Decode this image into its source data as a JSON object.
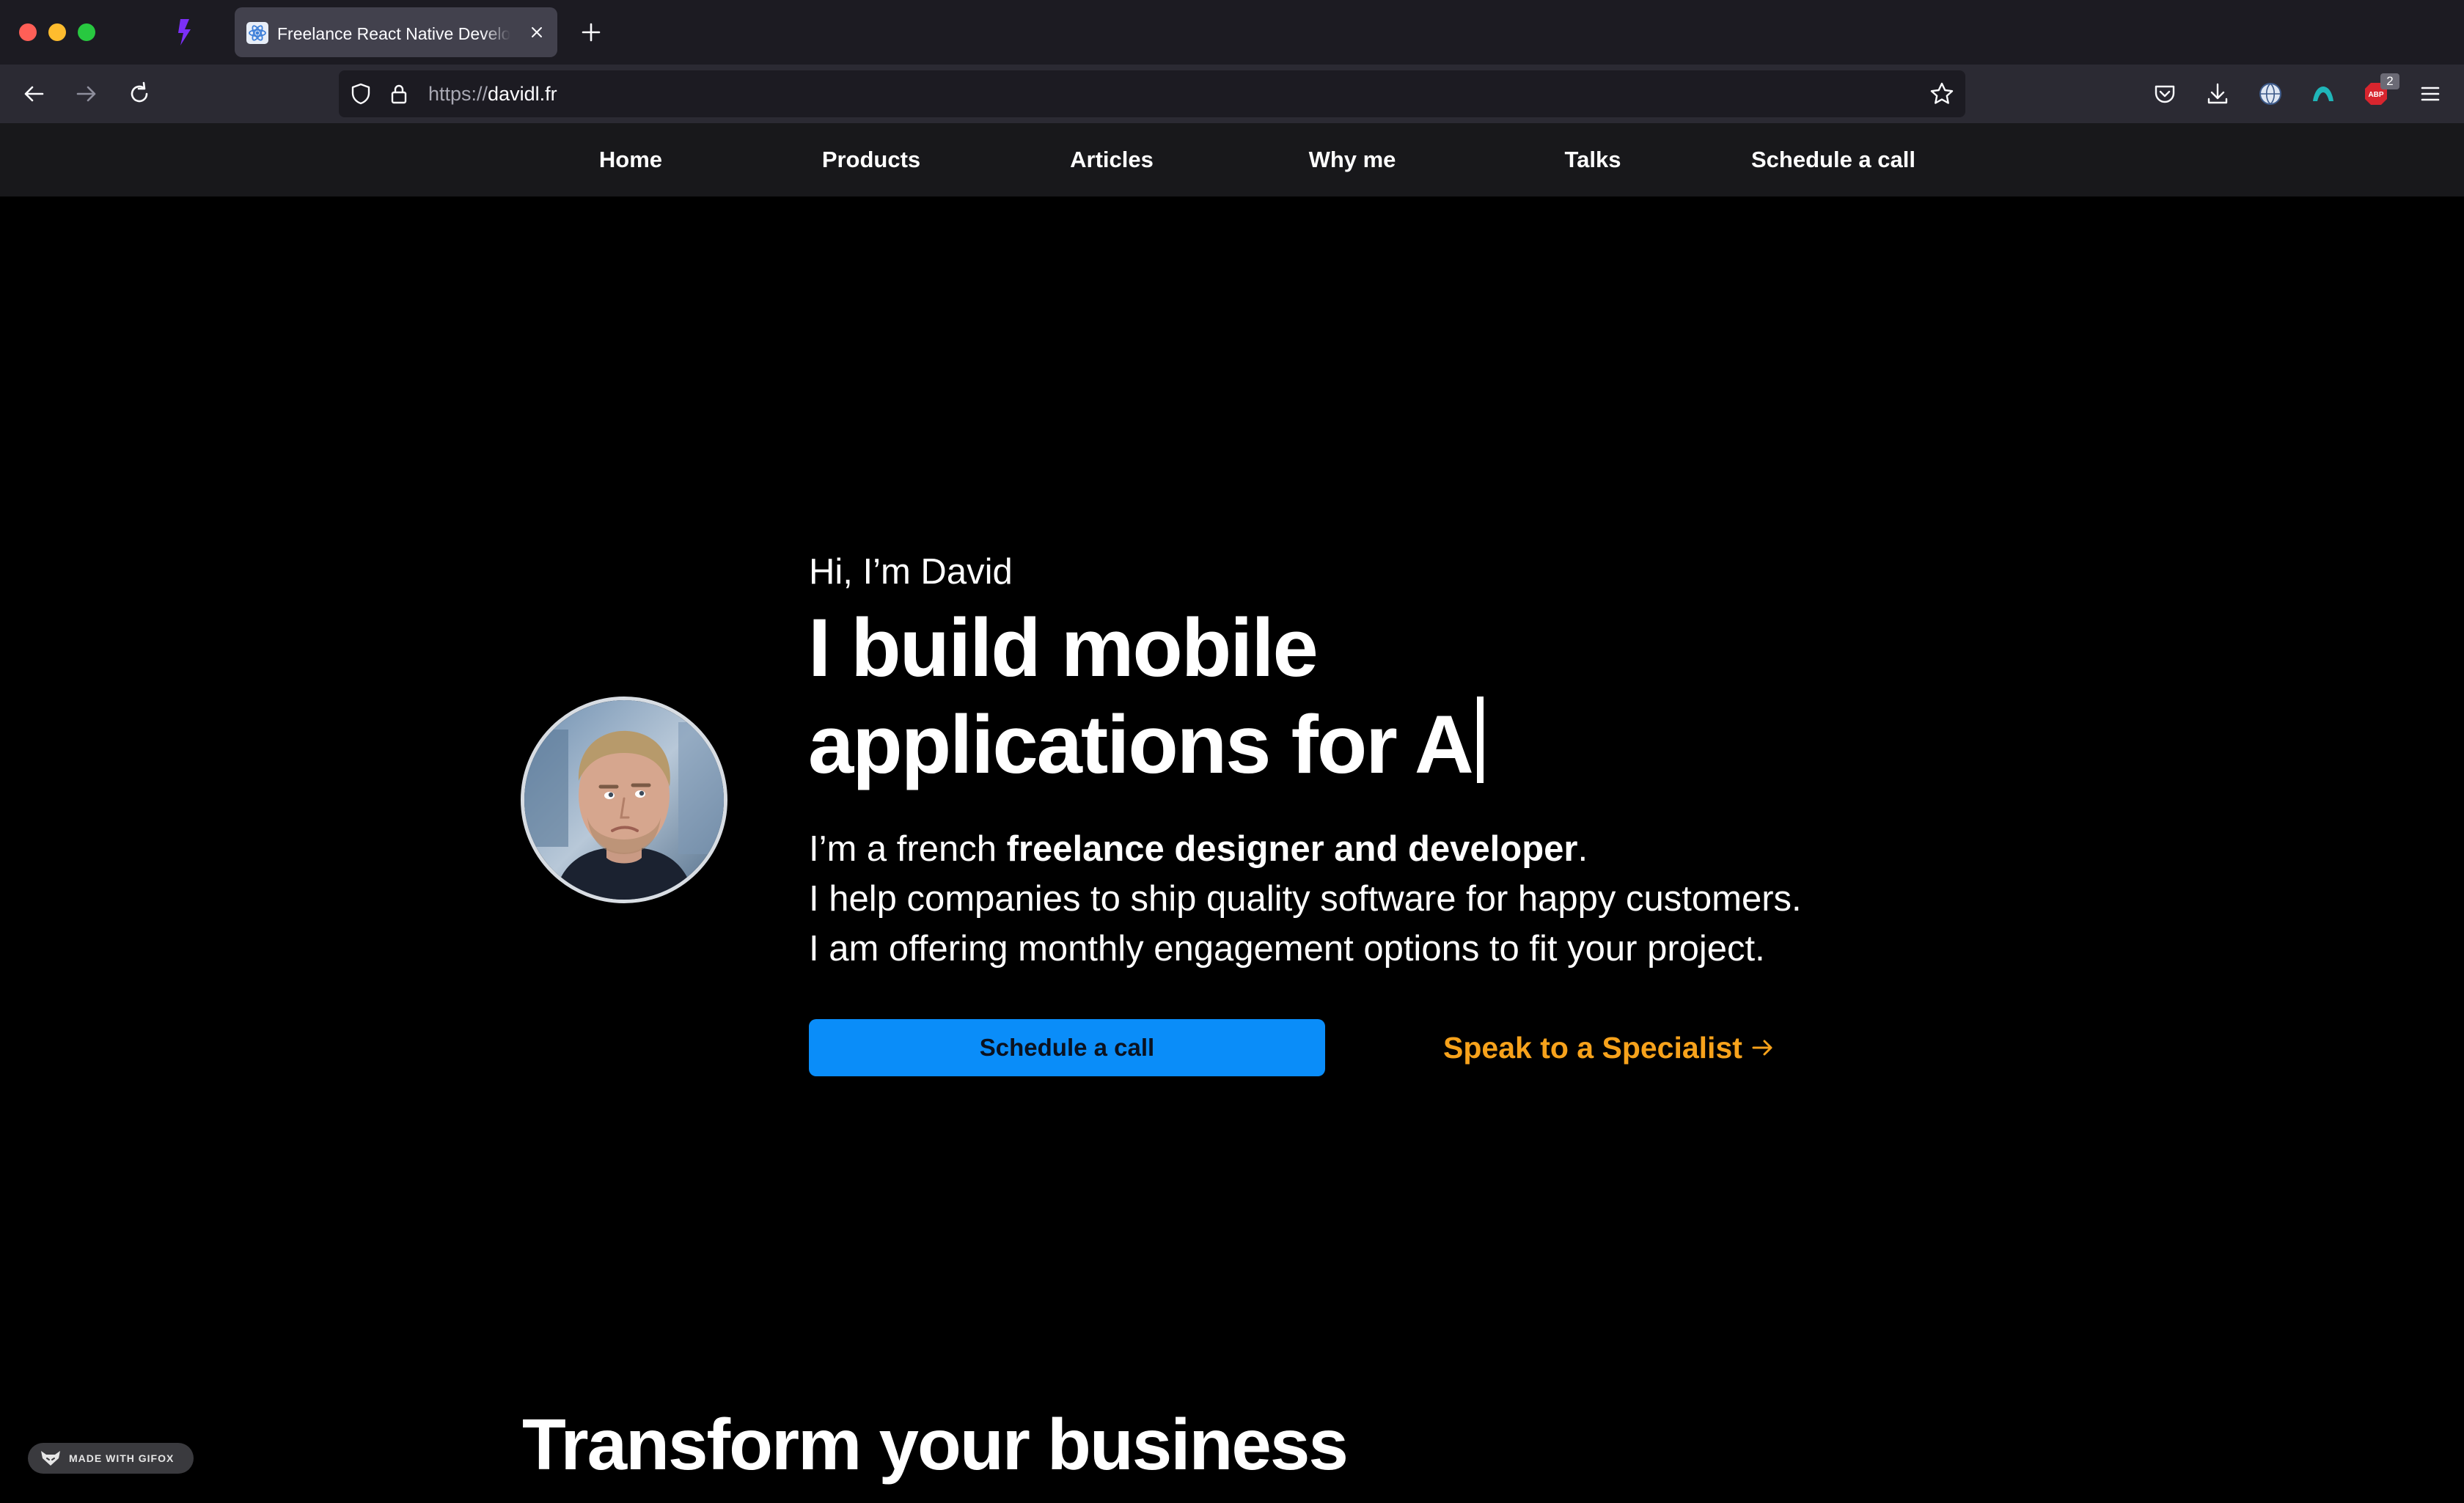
{
  "browser": {
    "tab": {
      "title": "Freelance React Native Developer",
      "favicon": "react-atom-icon"
    },
    "url": {
      "scheme": "https://",
      "host": "davidl.fr"
    },
    "icons": {
      "app": "lightning-icon",
      "back": "back-arrow-icon",
      "forward": "forward-arrow-icon",
      "reload": "reload-icon",
      "shield": "tracking-protection-shield-icon",
      "lock": "lock-icon",
      "bookmark": "star-icon",
      "pocket": "pocket-icon",
      "downloads": "download-icon",
      "extensions": [
        "globe-extension-icon",
        "teal-extension-icon",
        "adblock-icon"
      ],
      "menu": "hamburger-menu-icon"
    },
    "adblock_badge": "2"
  },
  "nav": {
    "items": [
      {
        "label": "Home"
      },
      {
        "label": "Products"
      },
      {
        "label": "Articles"
      },
      {
        "label": "Why me"
      },
      {
        "label": "Talks"
      },
      {
        "label": "Schedule a call"
      }
    ]
  },
  "hero": {
    "greeting": "Hi, I’m David",
    "headline_line1": "I build mobile",
    "headline_line2": "applications for A",
    "intro": {
      "l1_a": "I’m a french ",
      "l1_bold": "freelance designer and developer",
      "l1_c": ".",
      "l2": "I help companies to ship quality software for happy customers.",
      "l3": "I am offering monthly engagement options to fit your project."
    },
    "primary_cta": "Schedule a call",
    "secondary_cta": "Speak to a Specialist"
  },
  "section": {
    "title": "Transform your business"
  },
  "watermark": {
    "text": "MADE WITH GIFOX"
  },
  "colors": {
    "page_bg": "#000000",
    "nav_bg": "#18181b",
    "primary_button": "#0a8df9",
    "secondary_link": "#f7a21b",
    "browser_chrome": "#2b2a33"
  }
}
